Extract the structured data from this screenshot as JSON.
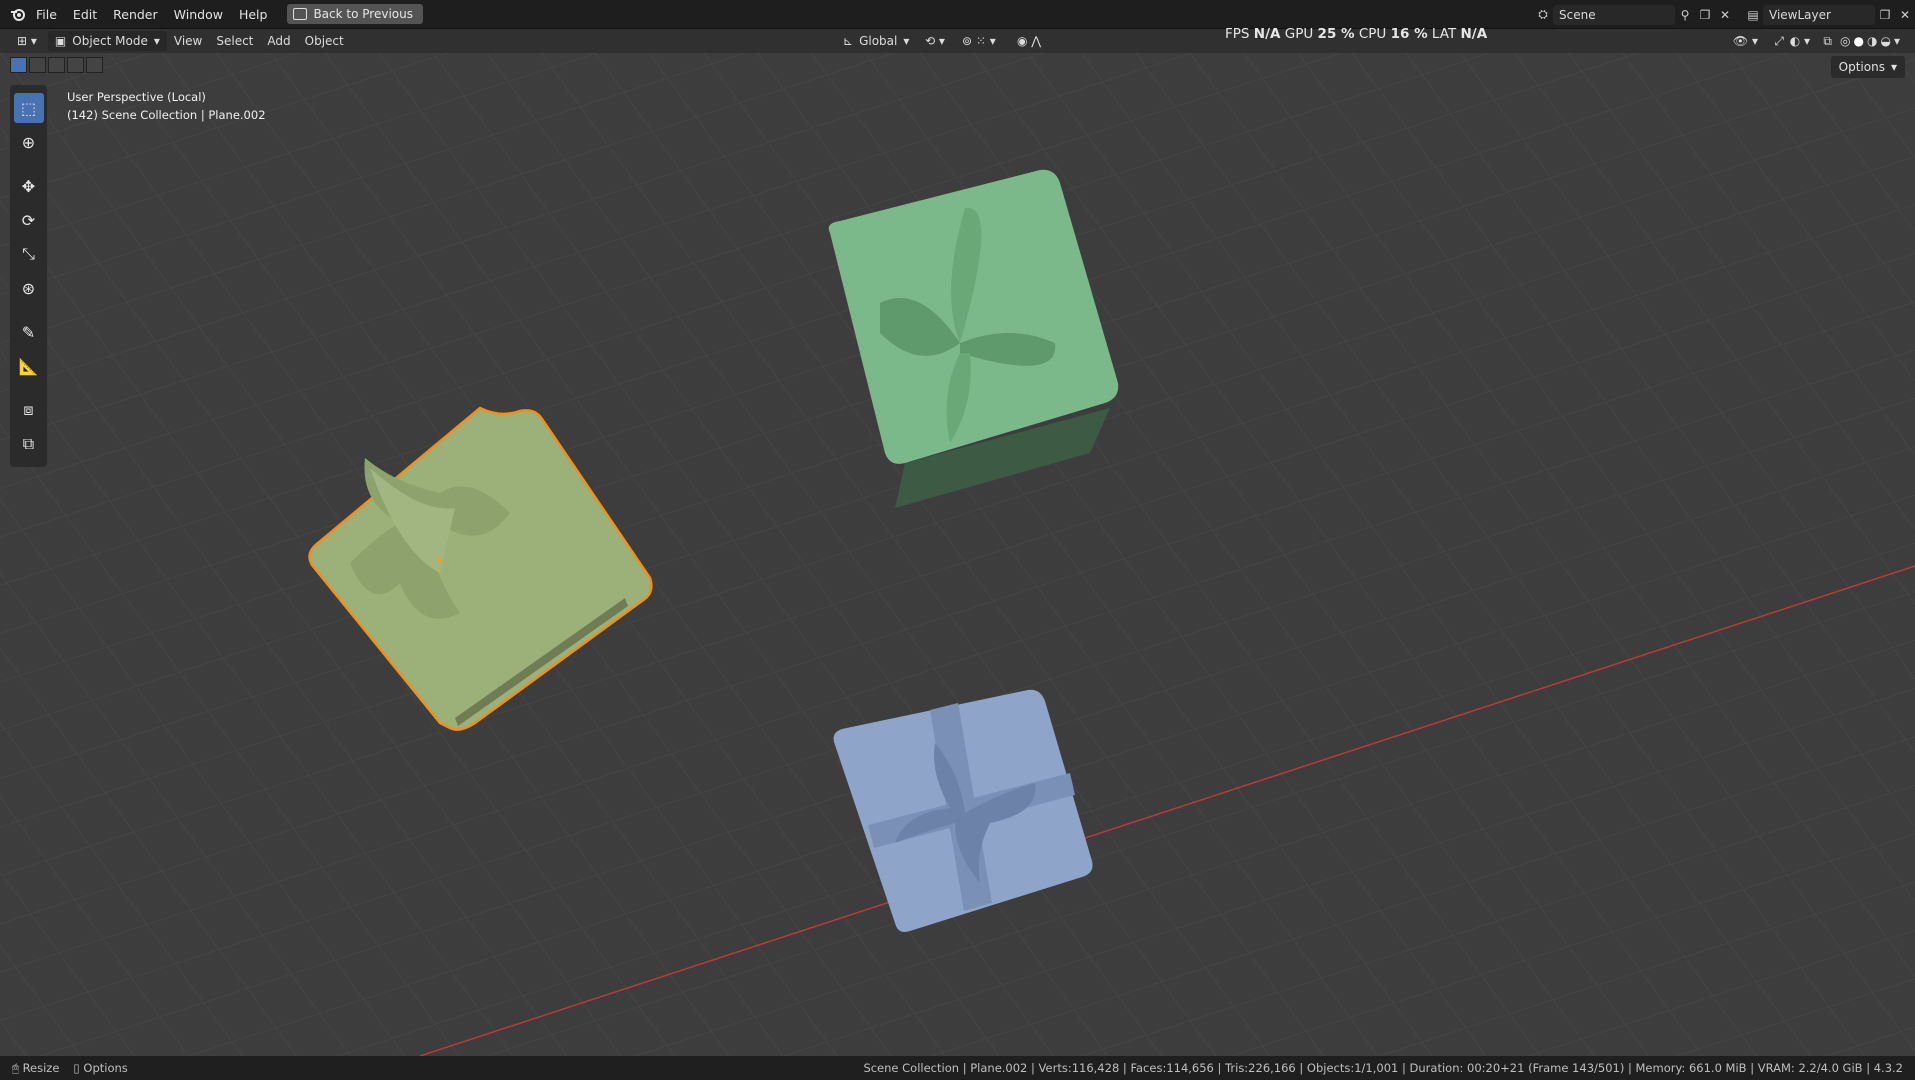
{
  "topbar": {
    "menu": [
      "File",
      "Edit",
      "Render",
      "Window",
      "Help"
    ],
    "back_label": "Back to Previous",
    "scene_label": "Scene",
    "viewlayer_label": "ViewLayer"
  },
  "header": {
    "mode_label": "Object Mode",
    "menus": [
      "View",
      "Select",
      "Add",
      "Object"
    ],
    "orientation_label": "Global",
    "options_label": "Options"
  },
  "perf": {
    "fps_label": "FPS",
    "fps_value": "N/A",
    "gpu_label": "GPU",
    "gpu_value": "25 %",
    "cpu_label": "CPU",
    "cpu_value": "16 %",
    "lat_label": "LAT",
    "lat_value": "N/A"
  },
  "viewport": {
    "perspective": "User Perspective (Local)",
    "collection": "(142) Scene Collection | Plane.002"
  },
  "status": {
    "left_items": [
      "Resize",
      "Options"
    ],
    "stats": "Scene Collection | Plane.002 | Verts:116,428 | Faces:114,656 | Tris:226,166 | Objects:1/1,001 | Duration: 00:20+21 (Frame 143/501) | Memory: 661.0 MiB | VRAM: 2.2/4.0 GiB | 4.3.2"
  },
  "colors": {
    "green_box": "#7cb98a",
    "olive_box": "#a9bf86",
    "blue_box": "#8ea4c9",
    "selection": "#f08f1c",
    "x_axis": "#b93a3a",
    "active_tool": "#4772b3"
  }
}
